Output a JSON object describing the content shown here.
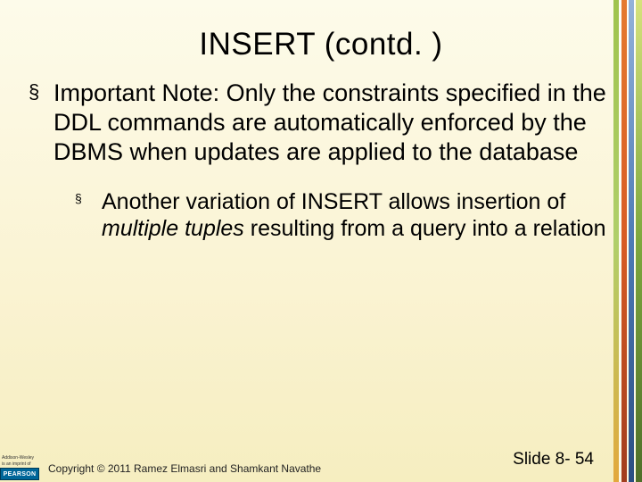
{
  "title": "INSERT (contd. )",
  "bullets": {
    "lvl1": "Important Note: Only the constraints specified in the DDL commands are automatically enforced by the DBMS when updates are applied to the database",
    "lvl2_a": "Another variation of INSERT allows insertion of ",
    "lvl2_b": "multiple tuples",
    "lvl2_c": " resulting from a query into a relation"
  },
  "footer": {
    "aw1": "Addison-Wesley",
    "aw2": "is an imprint of",
    "pearson": "PEARSON",
    "copyright": "Copyright © 2011 Ramez Elmasri and Shamkant Navathe",
    "slidenum": "Slide 8- 54"
  }
}
